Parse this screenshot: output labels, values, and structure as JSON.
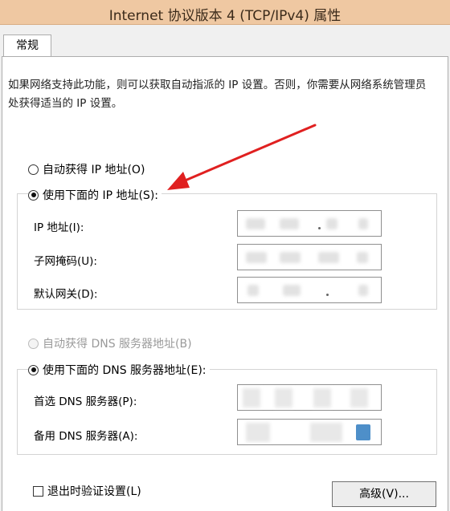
{
  "window": {
    "title": "Internet 协议版本 4 (TCP/IPv4) 属性"
  },
  "tabs": [
    {
      "label": "常规"
    }
  ],
  "general": {
    "description": "如果网络支持此功能，则可以获取自动指派的 IP 设置。否则，你需要从网络系统管理员处获得适当的 IP 设置。",
    "ip_auto_label": "自动获得 IP 地址(O)",
    "ip_manual_label": "使用下面的 IP 地址(S):",
    "ip_address_label": "IP 地址(I):",
    "subnet_mask_label": "子网掩码(U):",
    "gateway_label": "默认网关(D):",
    "dns_auto_label": "自动获得 DNS 服务器地址(B)",
    "dns_manual_label": "使用下面的 DNS 服务器地址(E):",
    "preferred_dns_label": "首选 DNS 服务器(P):",
    "alternate_dns_label": "备用 DNS 服务器(A):",
    "validate_label": "退出时验证设置(L)",
    "advanced_button": "高级(V)..."
  },
  "state": {
    "ip_mode": "manual",
    "dns_mode": "manual",
    "dns_auto_disabled": true,
    "validate_checked": false
  },
  "colors": {
    "titlebar": "#efc8a2",
    "arrow": "#e02020",
    "panel_bg": "#ffffff"
  }
}
